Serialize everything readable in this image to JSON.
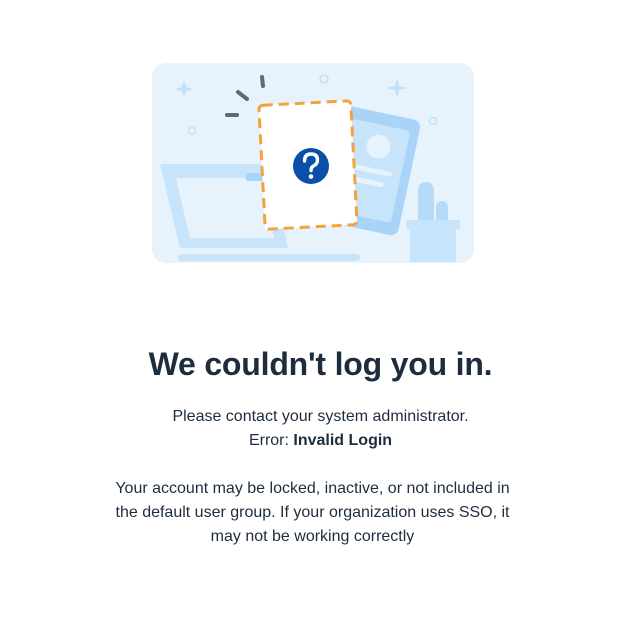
{
  "illustration": {
    "icon": "question-mark-icon",
    "colors": {
      "background": "#e8f4fd",
      "light_blue": "#c8e4fb",
      "mid_blue": "#a9d4f8",
      "accent_orange": "#f4a33a",
      "icon_blue": "#0a4fa8",
      "plant_green": "#b6dbf8",
      "spark_gray": "#5a6b7b"
    }
  },
  "message": {
    "title": "We couldn't log you in.",
    "contact": "Please contact your system administrator.",
    "error_label": "Error:",
    "error_value": "Invalid Login",
    "details": "Your account may be locked, inactive, or not included in the default user group. If your organization uses SSO, it may not be working correctly"
  }
}
